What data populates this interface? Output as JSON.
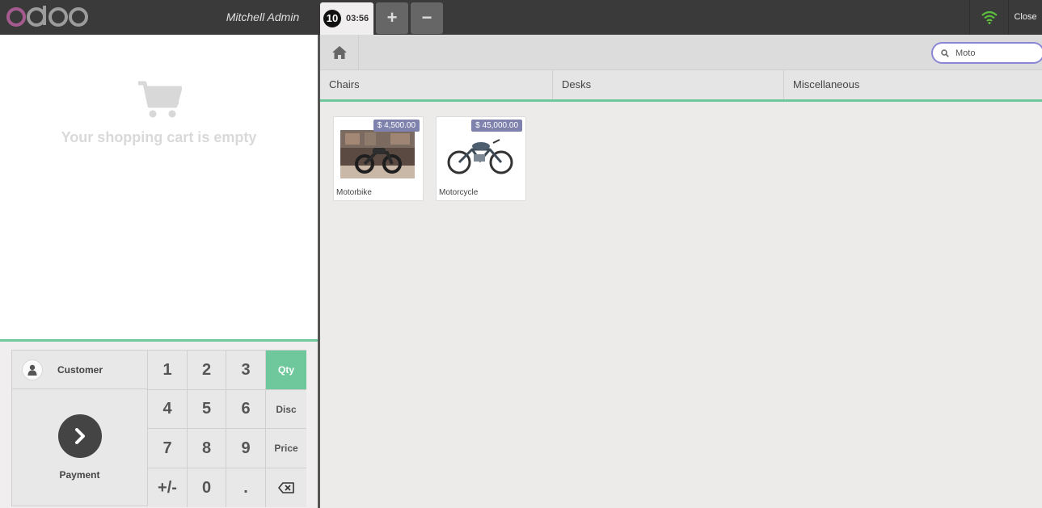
{
  "header": {
    "cashier": "Mitchell Admin",
    "order_number": "10",
    "order_time": "03:56",
    "add_order_label": "+",
    "remove_order_label": "−",
    "close_label": "Close"
  },
  "cart": {
    "empty_message": "Your shopping cart is empty"
  },
  "actions": {
    "customer_label": "Customer",
    "payment_label": "Payment"
  },
  "numpad": {
    "keys": [
      "1",
      "2",
      "3",
      "Qty",
      "4",
      "5",
      "6",
      "Disc",
      "7",
      "8",
      "9",
      "Price",
      "+/-",
      "0",
      "."
    ],
    "active_mode": "Qty"
  },
  "search": {
    "value": "Moto"
  },
  "categories": [
    "Chairs",
    "Desks",
    "Miscellaneous"
  ],
  "products": [
    {
      "name": "Motorbike",
      "price": "$ 4,500.00"
    },
    {
      "name": "Motorcycle",
      "price": "$ 45,000.00"
    }
  ],
  "colors": {
    "accent_green": "#6ec89b",
    "topbar": "#3a3a3a",
    "price_tag": "#7f82ad",
    "search_border": "#8a86d6",
    "wifi_green": "#5cbf3c"
  }
}
